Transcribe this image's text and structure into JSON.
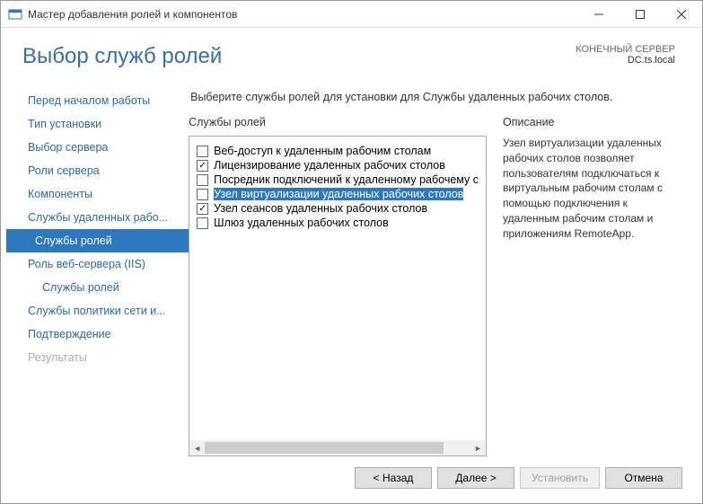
{
  "window": {
    "title": "Мастер добавления ролей и компонентов"
  },
  "header": {
    "page_title": "Выбор служб ролей",
    "dest_label": "КОНЕЧНЫЙ СЕРВЕР",
    "dest_value": "DC.ts.local"
  },
  "nav": {
    "items": [
      {
        "label": "Перед началом работы"
      },
      {
        "label": "Тип установки"
      },
      {
        "label": "Выбор сервера"
      },
      {
        "label": "Роли сервера"
      },
      {
        "label": "Компоненты"
      },
      {
        "label": "Службы удаленных рабо..."
      },
      {
        "label": "Службы ролей"
      },
      {
        "label": "Роль веб-сервера (IIS)"
      },
      {
        "label": "Службы ролей"
      },
      {
        "label": "Службы политики сети и..."
      },
      {
        "label": "Подтверждение"
      },
      {
        "label": "Результаты"
      }
    ]
  },
  "content": {
    "prompt": "Выберите службы ролей для установки для Службы удаленных рабочих столов.",
    "services_title": "Службы ролей",
    "description_title": "Описание",
    "services": [
      {
        "label": "Веб-доступ к удаленным рабочим столам"
      },
      {
        "label": "Лицензирование удаленных рабочих столов"
      },
      {
        "label": "Посредник подключений к удаленному рабочему с"
      },
      {
        "label": "Узел виртуализации удаленных рабочих столов"
      },
      {
        "label": "Узел сеансов удаленных рабочих столов"
      },
      {
        "label": "Шлюз удаленных рабочих столов"
      }
    ],
    "description": "Узел виртуализации удаленных рабочих столов  позволяет пользователям подключаться к виртуальным рабочим столам с помощью подключения к удаленным рабочим столам и приложениям RemoteApp."
  },
  "footer": {
    "back": "< Назад",
    "next": "Далее >",
    "install": "Установить",
    "cancel": "Отмена"
  }
}
